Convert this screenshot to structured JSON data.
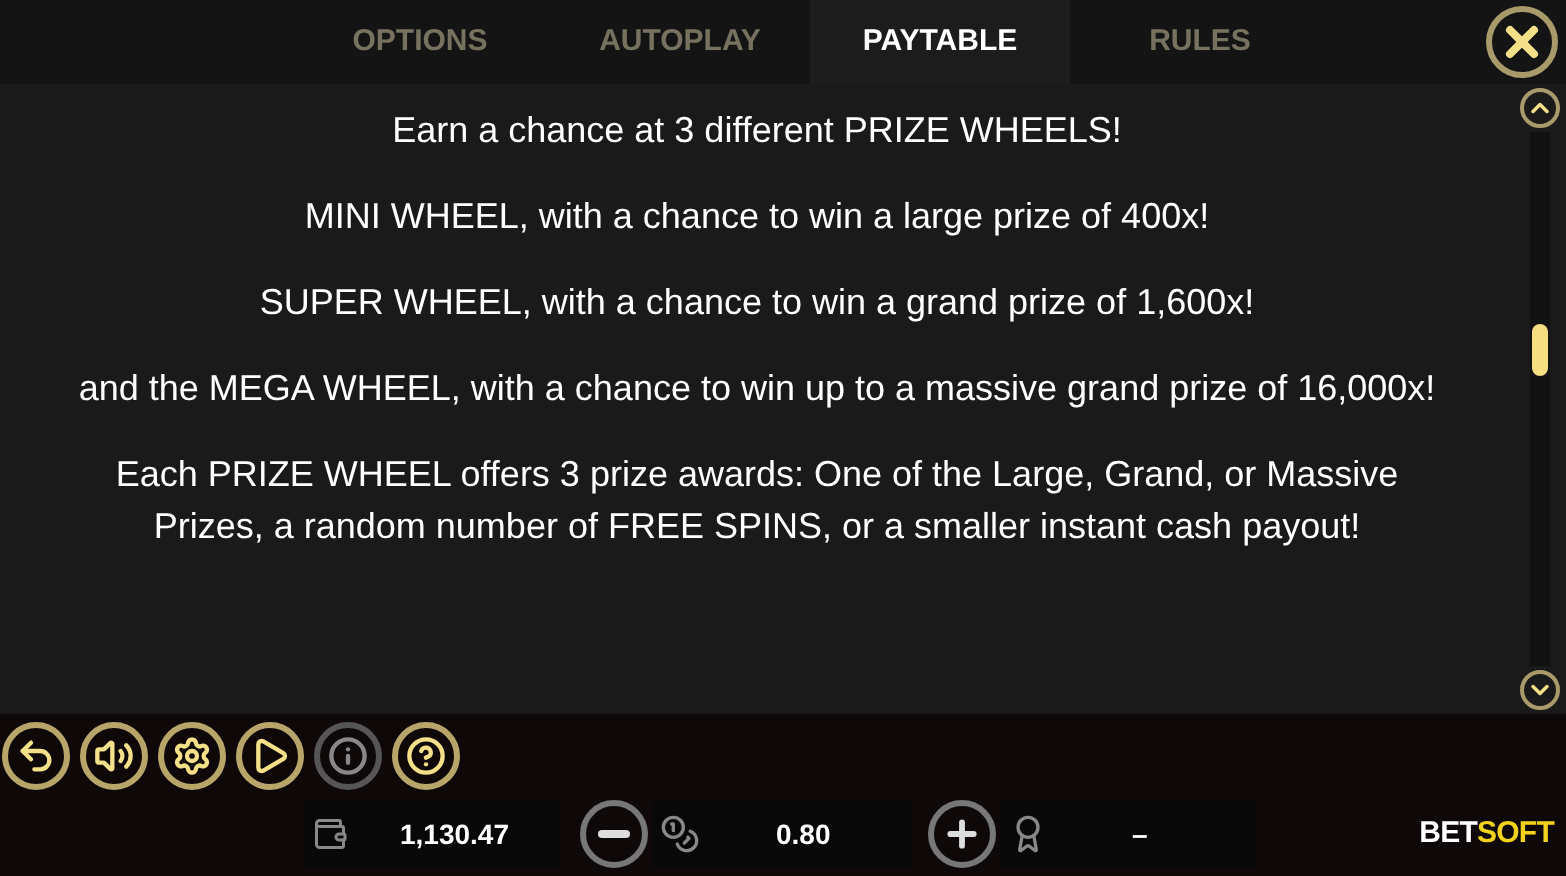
{
  "tabs": [
    {
      "label": "OPTIONS",
      "selected": false
    },
    {
      "label": "AUTOPLAY",
      "selected": false
    },
    {
      "label": "PAYTABLE",
      "selected": true
    },
    {
      "label": "RULES",
      "selected": false
    }
  ],
  "paragraphs": [
    "Earn a chance at 3 different PRIZE WHEELS!",
    "MINI WHEEL, with a chance to win a large prize of 400x!",
    "SUPER WHEEL, with a chance to win a grand prize of 1,600x!",
    "and the MEGA WHEEL, with a chance to win up to a massive grand prize of 16,000x!",
    "Each PRIZE WHEEL offers 3 prize awards: One of the Large, Grand, or Massive Prizes, a random number of FREE SPINS, or a smaller instant cash payout!"
  ],
  "toolbar": [
    {
      "kind": "back",
      "disabled": false
    },
    {
      "kind": "sound",
      "disabled": false
    },
    {
      "kind": "settings",
      "disabled": false
    },
    {
      "kind": "autoplay",
      "disabled": false
    },
    {
      "kind": "info",
      "disabled": true
    },
    {
      "kind": "help",
      "disabled": false
    }
  ],
  "balance": "1,130.47",
  "bet": "0.80",
  "win": "–",
  "logo": {
    "part1": "BET",
    "part2": "SOFT"
  }
}
